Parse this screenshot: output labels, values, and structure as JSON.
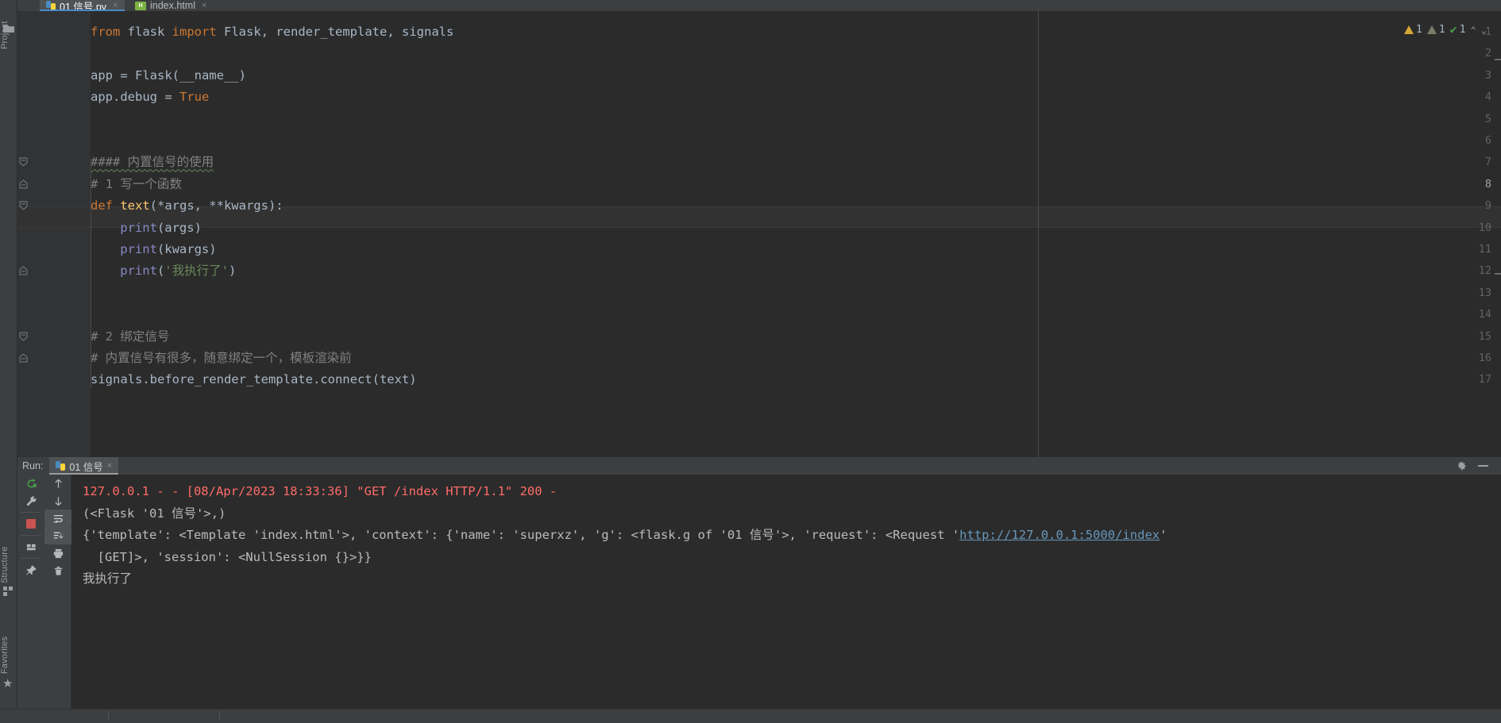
{
  "window": {
    "accent": "#4a88c7",
    "editor_bg": "#2b2b2b",
    "chrome_bg": "#3c3f41"
  },
  "left_strip": {
    "project_label": "Project",
    "structure_label": "Structure",
    "favorites_label": "Favorites",
    "icons": {
      "folder": "folder-icon",
      "structure": "structure-icon",
      "star": "★"
    }
  },
  "tabs": [
    {
      "label": "01 信号.py",
      "icon": "python-file-icon",
      "close": "×",
      "active": true
    },
    {
      "label": "index.html",
      "icon": "html-file-icon",
      "close": "×",
      "active": false
    }
  ],
  "inspections": {
    "warning_count": "1",
    "weak_warning_count": "1",
    "ok_count": "1",
    "up_chevron": "⌃",
    "down_chevron": "⌄"
  },
  "editor": {
    "current_line": 8,
    "lines": [
      {
        "n": "1",
        "indent": 0,
        "tokens": [
          {
            "t": "from ",
            "c": "kw"
          },
          {
            "t": "flask ",
            "c": "pn"
          },
          {
            "t": "import ",
            "c": "kw"
          },
          {
            "t": "Flask",
            "c": "pn"
          },
          {
            "t": ", ",
            "c": "pn"
          },
          {
            "t": "render_template",
            "c": "pn"
          },
          {
            "t": ", ",
            "c": "pn"
          },
          {
            "t": "signals",
            "c": "pn"
          }
        ]
      },
      {
        "n": "2",
        "indent": 0,
        "tokens": []
      },
      {
        "n": "3",
        "indent": 0,
        "tokens": [
          {
            "t": "app = Flask(__name__)",
            "c": "pn"
          }
        ]
      },
      {
        "n": "4",
        "indent": 0,
        "tokens": [
          {
            "t": "app.debug = ",
            "c": "pn"
          },
          {
            "t": "True",
            "c": "kw"
          }
        ]
      },
      {
        "n": "5",
        "indent": 0,
        "tokens": []
      },
      {
        "n": "6",
        "indent": 0,
        "tokens": []
      },
      {
        "n": "7",
        "indent": 0,
        "fold": "open",
        "squiggle": true,
        "tokens": [
          {
            "t": "#### 内置信号的使用",
            "c": "cmt"
          }
        ]
      },
      {
        "n": "8",
        "indent": 0,
        "fold": "close",
        "tokens": [
          {
            "t": "# 1 写一个函数",
            "c": "cmt"
          }
        ]
      },
      {
        "n": "9",
        "indent": 0,
        "fold": "open",
        "tokens": [
          {
            "t": "def ",
            "c": "kw"
          },
          {
            "t": "text",
            "c": "fn"
          },
          {
            "t": "(*args, **kwargs):",
            "c": "pn"
          }
        ]
      },
      {
        "n": "10",
        "indent": 1,
        "tokens": [
          {
            "t": "print",
            "c": "bi"
          },
          {
            "t": "(args)",
            "c": "pn"
          }
        ]
      },
      {
        "n": "11",
        "indent": 1,
        "tokens": [
          {
            "t": "print",
            "c": "bi"
          },
          {
            "t": "(kwargs)",
            "c": "pn"
          }
        ]
      },
      {
        "n": "12",
        "indent": 1,
        "fold": "close",
        "tokens": [
          {
            "t": "print",
            "c": "bi"
          },
          {
            "t": "(",
            "c": "pn"
          },
          {
            "t": "'我执行了'",
            "c": "str"
          },
          {
            "t": ")",
            "c": "pn"
          }
        ]
      },
      {
        "n": "13",
        "indent": 0,
        "tokens": []
      },
      {
        "n": "14",
        "indent": 0,
        "tokens": []
      },
      {
        "n": "15",
        "indent": 0,
        "fold": "open",
        "tokens": [
          {
            "t": "# 2 绑定信号",
            "c": "cmt"
          }
        ]
      },
      {
        "n": "16",
        "indent": 0,
        "fold": "close",
        "tokens": [
          {
            "t": "# 内置信号有很多，随意绑定一个，模板渲染前",
            "c": "cmt"
          }
        ]
      },
      {
        "n": "17",
        "indent": 0,
        "tokens": [
          {
            "t": "signals.before_render_template.connect(text)",
            "c": "pn"
          }
        ]
      }
    ]
  },
  "run_panel": {
    "label": "Run:",
    "tab": {
      "label": "01 信号",
      "icon": "python-run-icon",
      "close": "×"
    },
    "settings_icon": "gear-icon",
    "minimize_icon": "minimize-icon",
    "toolbar_left": [
      "rerun-icon",
      "settings-wrench-icon",
      "stop-icon",
      "layout-icon",
      "pin-icon"
    ],
    "toolbar_right": [
      "scroll-up-icon",
      "scroll-down-icon",
      "soft-wrap-icon",
      "scroll-to-end-icon",
      "print-icon",
      "trash-icon"
    ],
    "console_lines": [
      {
        "kind": "error",
        "text": "127.0.0.1 - - [08/Apr/2023 18:33:36] \"GET /index HTTP/1.1\" 200 -"
      },
      {
        "kind": "plain",
        "text": "(<Flask '01 信号'>,)"
      },
      {
        "kind": "link",
        "pre": "{'template': <Template 'index.html'>, 'context': {'name': 'superxz', 'g': <flask.g of '01 信号'>, 'request': <Request '",
        "link": "http://127.0.0.1:5000/index",
        "post": "'"
      },
      {
        "kind": "plain",
        "text": "  [GET]>, 'session': <NullSession {}>}}"
      },
      {
        "kind": "plain",
        "text": "我执行了"
      }
    ]
  }
}
